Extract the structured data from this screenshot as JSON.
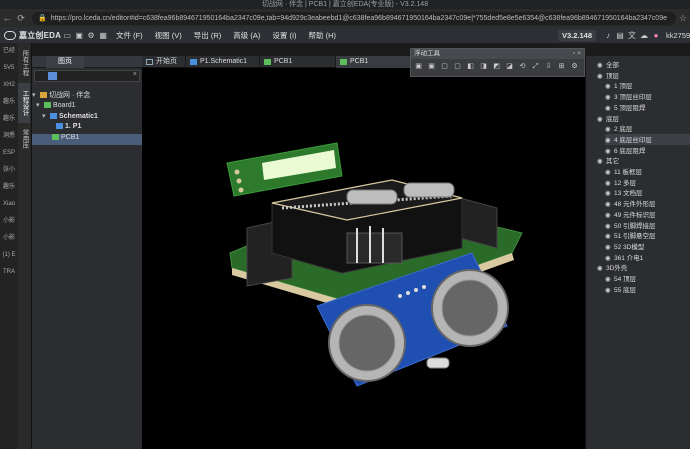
{
  "browser": {
    "title": "切战网 · 伴念 | PCB1 | 嘉立创EDA(专业版) - V3.2.148",
    "url": "https://pro.lceda.cn/editor#id=c638fea96b894671950164ba2347c09e,tab=94d929c3eabeebd1@c638fea96b894671950164ba2347c09e|*755ded5e8e5e6354@c638fea96b894671950164ba2347c09e"
  },
  "app": {
    "brand": "嘉立创EDA",
    "version": "V3.2.148",
    "user": "kk27592",
    "menus": [
      "文件 (F)",
      "视图 (V)",
      "导出 (R)",
      "高级 (A)",
      "设置 (I)",
      "帮助 (H)"
    ]
  },
  "left_strip": [
    "已经",
    "5V5",
    "XH2",
    "趣乐",
    "趣乐",
    "洞悉",
    "ESP",
    "张小",
    "趣乐",
    "Xiao",
    "小影",
    "小影",
    "(1) E",
    "TRA"
  ],
  "side_tabs": [
    "所有工程",
    "工程设计",
    "常用库"
  ],
  "panel": {
    "tab_label": "图页",
    "tree": [
      {
        "label": "切战网 · 伴念",
        "level": 0
      },
      {
        "label": "Board1",
        "level": 1
      },
      {
        "label": "Schematic1",
        "level": 2
      },
      {
        "label": "1. P1",
        "level": 3
      },
      {
        "label": "PCB1",
        "level": 2
      }
    ]
  },
  "doc_tabs": [
    {
      "label": "开始页",
      "active": false
    },
    {
      "label": "P1.Schematic1",
      "active": false
    },
    {
      "label": "PCB1",
      "active": false
    },
    {
      "label": "PCB1",
      "active": true
    }
  ],
  "float_tool": {
    "title": "浮动工具"
  },
  "layer_panel": [
    {
      "label": "全部",
      "kind": "group",
      "selected": false
    },
    {
      "label": "顶层",
      "kind": "group",
      "selected": false
    },
    {
      "label": "1 顶层",
      "kind": "item",
      "selected": false
    },
    {
      "label": "3 顶层丝印层",
      "kind": "item",
      "selected": false
    },
    {
      "label": "5 顶层阻焊",
      "kind": "item",
      "selected": false
    },
    {
      "label": "底层",
      "kind": "group",
      "selected": false
    },
    {
      "label": "2 底层",
      "kind": "item",
      "selected": false
    },
    {
      "label": "4 底层丝印层",
      "kind": "item",
      "selected": true
    },
    {
      "label": "6 底层阻焊",
      "kind": "item",
      "selected": false
    },
    {
      "label": "其它",
      "kind": "group",
      "selected": false
    },
    {
      "label": "11 板框层",
      "kind": "item",
      "selected": false
    },
    {
      "label": "12 多层",
      "kind": "item",
      "selected": false
    },
    {
      "label": "13 文档层",
      "kind": "item",
      "selected": false
    },
    {
      "label": "48 元件外形层",
      "kind": "item",
      "selected": false
    },
    {
      "label": "49 元件标识层",
      "kind": "item",
      "selected": false
    },
    {
      "label": "50 引脚焊接层",
      "kind": "item",
      "selected": false
    },
    {
      "label": "51 引脚悬空层",
      "kind": "item",
      "selected": false
    },
    {
      "label": "52 3D模型",
      "kind": "item",
      "selected": false
    },
    {
      "label": "361 介电1",
      "kind": "item",
      "selected": false
    },
    {
      "label": "3D外壳",
      "kind": "group",
      "selected": false
    },
    {
      "label": "54 顶层",
      "kind": "item",
      "selected": false
    },
    {
      "label": "55 底层",
      "kind": "item",
      "selected": false
    }
  ],
  "colors": {
    "accent": "#5a8fd8",
    "selection": "#495d78",
    "sensor_pcb": "#1f4fb0",
    "pcb_green": "#2b6b2a",
    "silk_gold": "#d8c9a0"
  }
}
